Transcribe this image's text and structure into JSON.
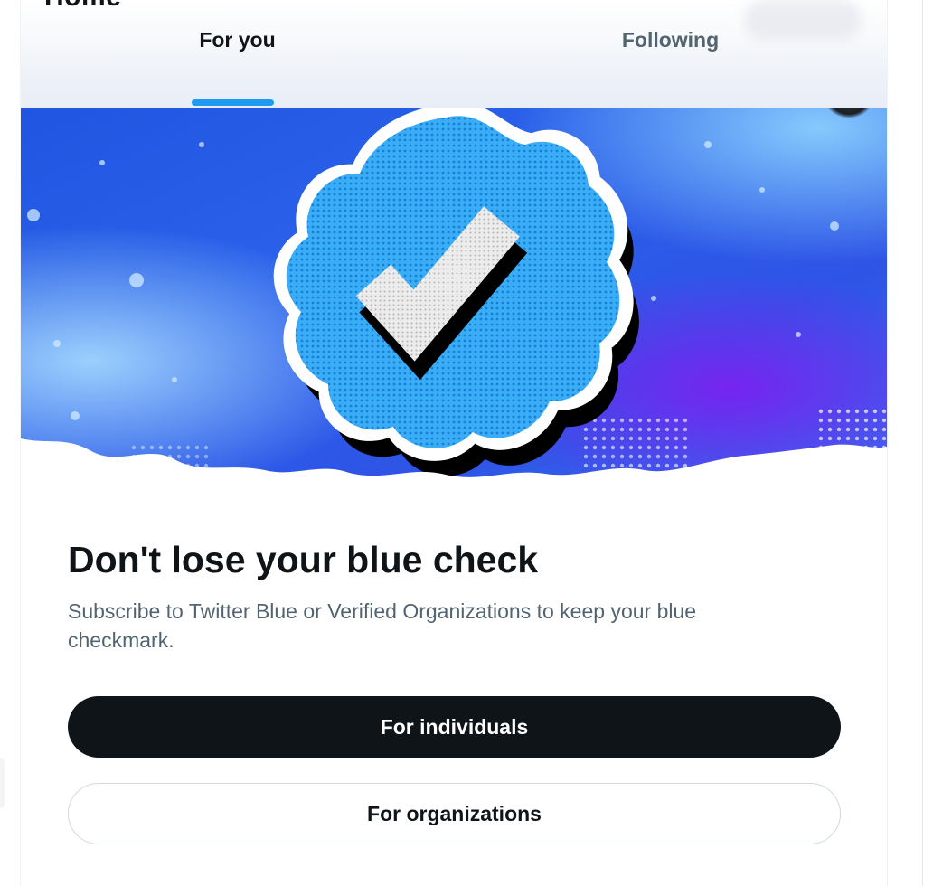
{
  "header": {
    "title": "Home",
    "tabs": [
      {
        "label": "For you",
        "selected": true
      },
      {
        "label": "Following",
        "selected": false
      }
    ]
  },
  "banner": {
    "image": "verified-blue-checkmark-illustration",
    "colors": {
      "check_badge": "#2ea8f5",
      "background_blue": "#2a5bea",
      "background_purple": "#6b2ff0"
    }
  },
  "promo": {
    "title": "Don't lose your blue check",
    "subtitle": "Subscribe to Twitter Blue or Verified Organizations to keep your blue checkmark.",
    "primary_button": "For individuals",
    "secondary_button": "For organizations"
  },
  "colors": {
    "accent": "#1d9bf0",
    "text_primary": "#0f1419",
    "text_secondary": "#536471"
  }
}
